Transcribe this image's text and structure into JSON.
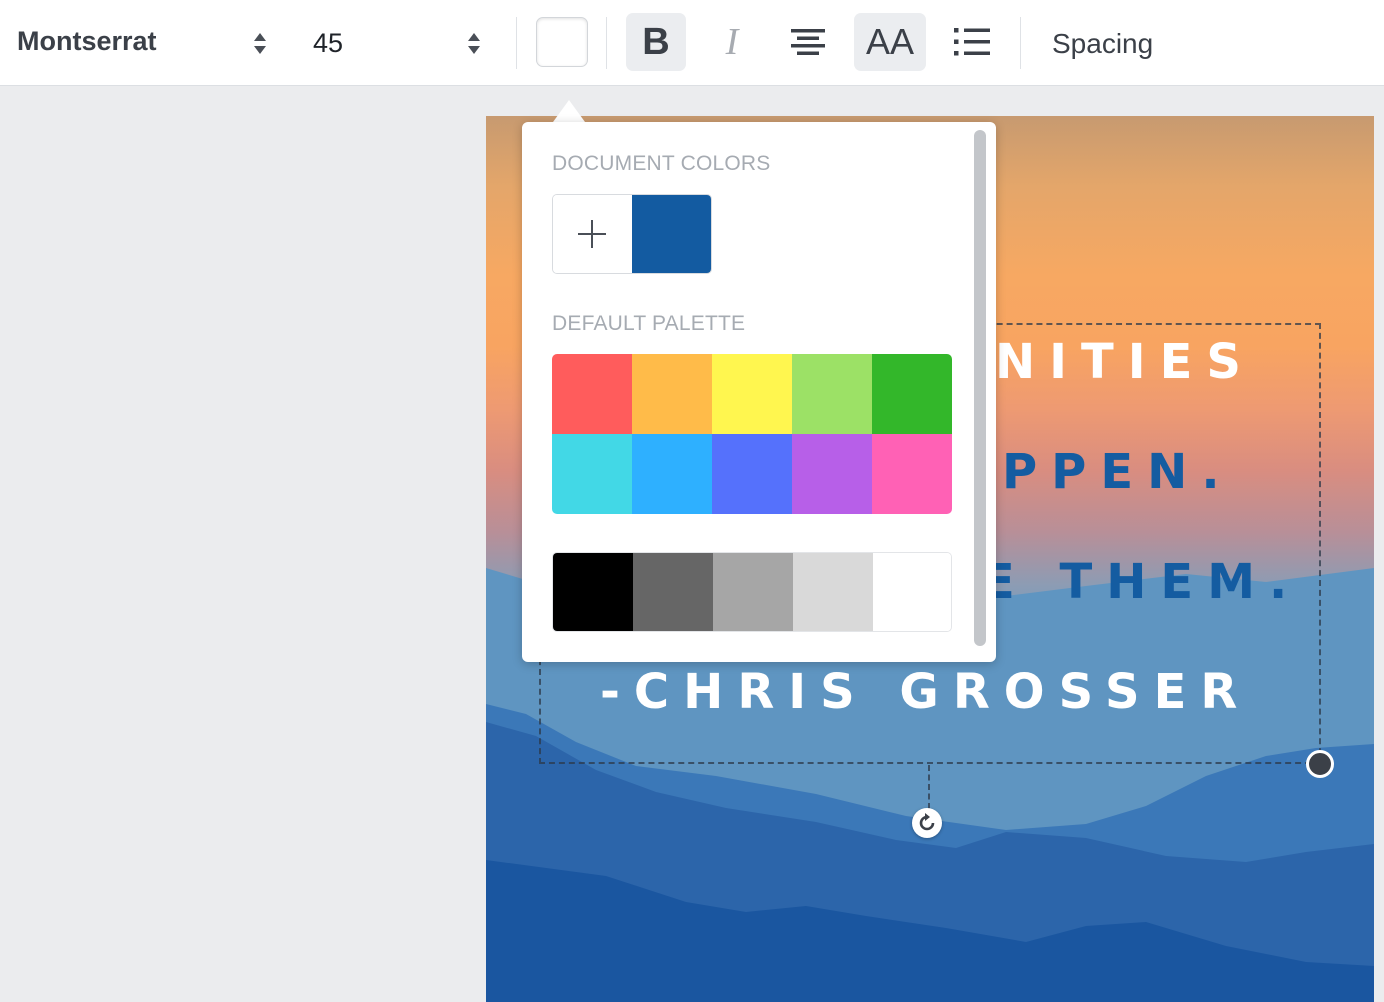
{
  "toolbar": {
    "font_family": "Montserrat",
    "font_size": "45",
    "text_color": "#ffffff",
    "bold_label": "B",
    "italic_label": "I",
    "case_label": "AA",
    "spacing_label": "Spacing"
  },
  "design": {
    "lines": [
      {
        "text": "NITIES",
        "color": "#ffffff"
      },
      {
        "text": "PPEN.",
        "color": "#145ca1"
      },
      {
        "text": "E THEM.",
        "color": "#145ca1"
      },
      {
        "text": "-CHRIS GROSSER",
        "color": "#ffffff"
      }
    ]
  },
  "color_picker": {
    "document_colors_label": "DOCUMENT COLORS",
    "document_colors": [
      "#135ba1"
    ],
    "default_palette_label": "DEFAULT PALETTE",
    "palette": [
      "#ff5c5c",
      "#ffbb49",
      "#fff64f",
      "#9ce166",
      "#33b72a",
      "#42d8e6",
      "#2eb0ff",
      "#5571fc",
      "#b75fe8",
      "#ff61b5"
    ],
    "grays": [
      "#000000",
      "#666666",
      "#a6a6a6",
      "#d9d9d9",
      "#ffffff"
    ]
  }
}
